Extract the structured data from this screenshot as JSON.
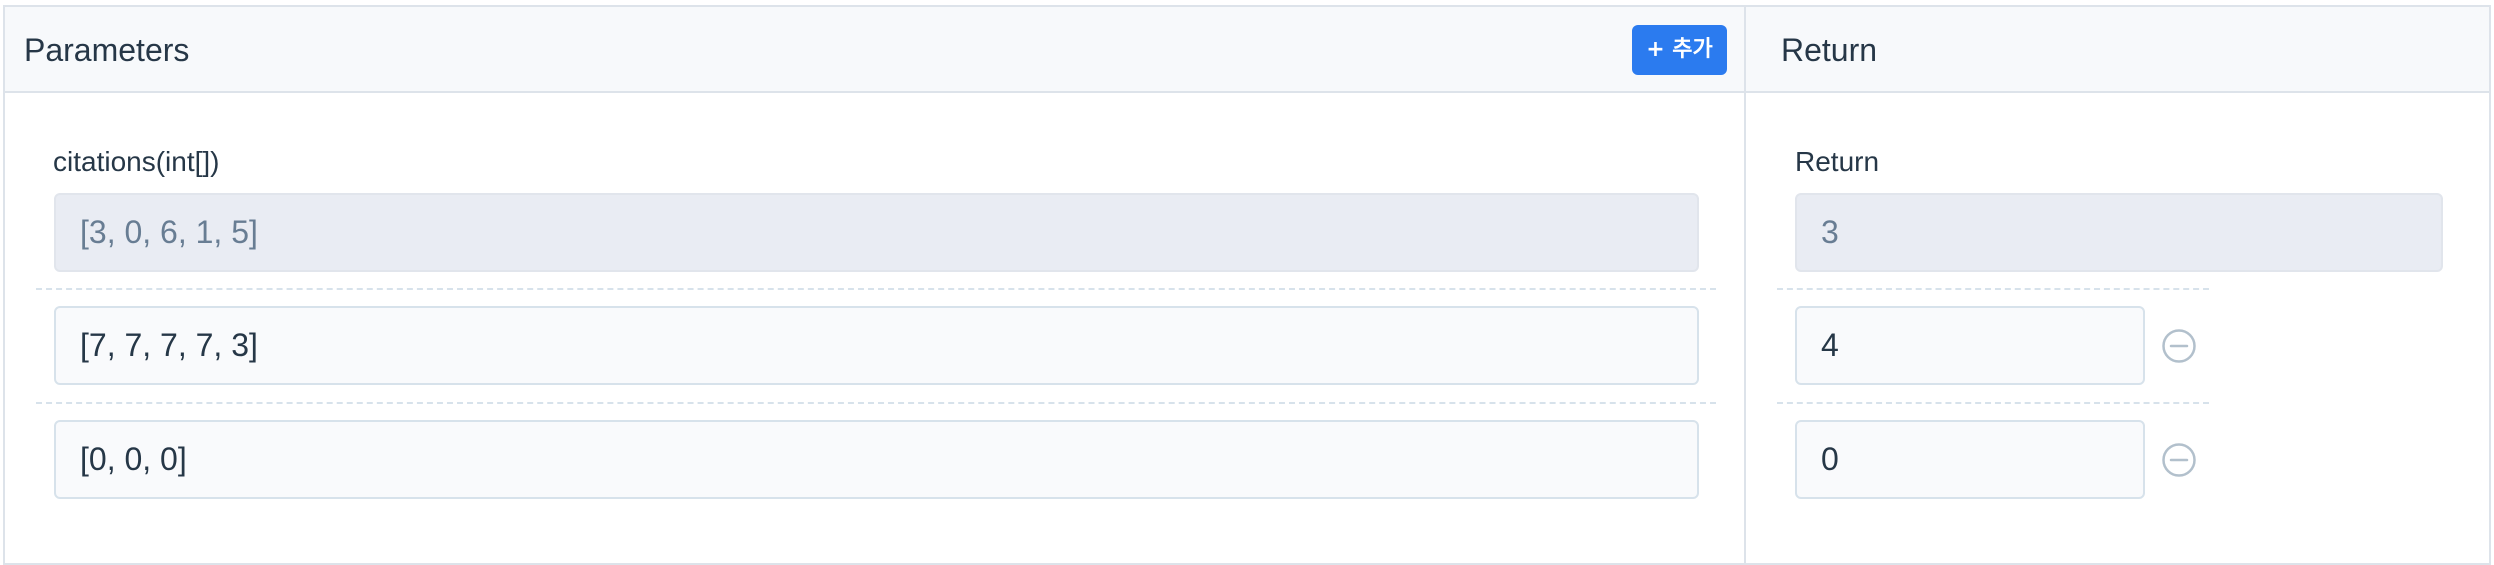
{
  "params_panel": {
    "title": "Parameters",
    "add_label": "+ 추가",
    "param_label": "citations(int[])",
    "rows": [
      {
        "value": "[3, 0, 6, 1, 5]",
        "readonly": true
      },
      {
        "value": "[7, 7, 7, 7, 3]",
        "readonly": false
      },
      {
        "value": "[0, 0, 0]",
        "readonly": false
      }
    ]
  },
  "return_panel": {
    "title": "Return",
    "field_label": "Return",
    "rows": [
      {
        "value": "3",
        "readonly": true
      },
      {
        "value": "4",
        "readonly": false,
        "removable": true
      },
      {
        "value": "0",
        "readonly": false,
        "removable": true
      }
    ]
  },
  "colors": {
    "accent": "#2b7bef",
    "border": "#dde3ea",
    "readonly_bg": "#e9ecf3",
    "remove_icon": "#b2c0cc"
  },
  "icons": {
    "remove": "minus-circle-icon"
  }
}
